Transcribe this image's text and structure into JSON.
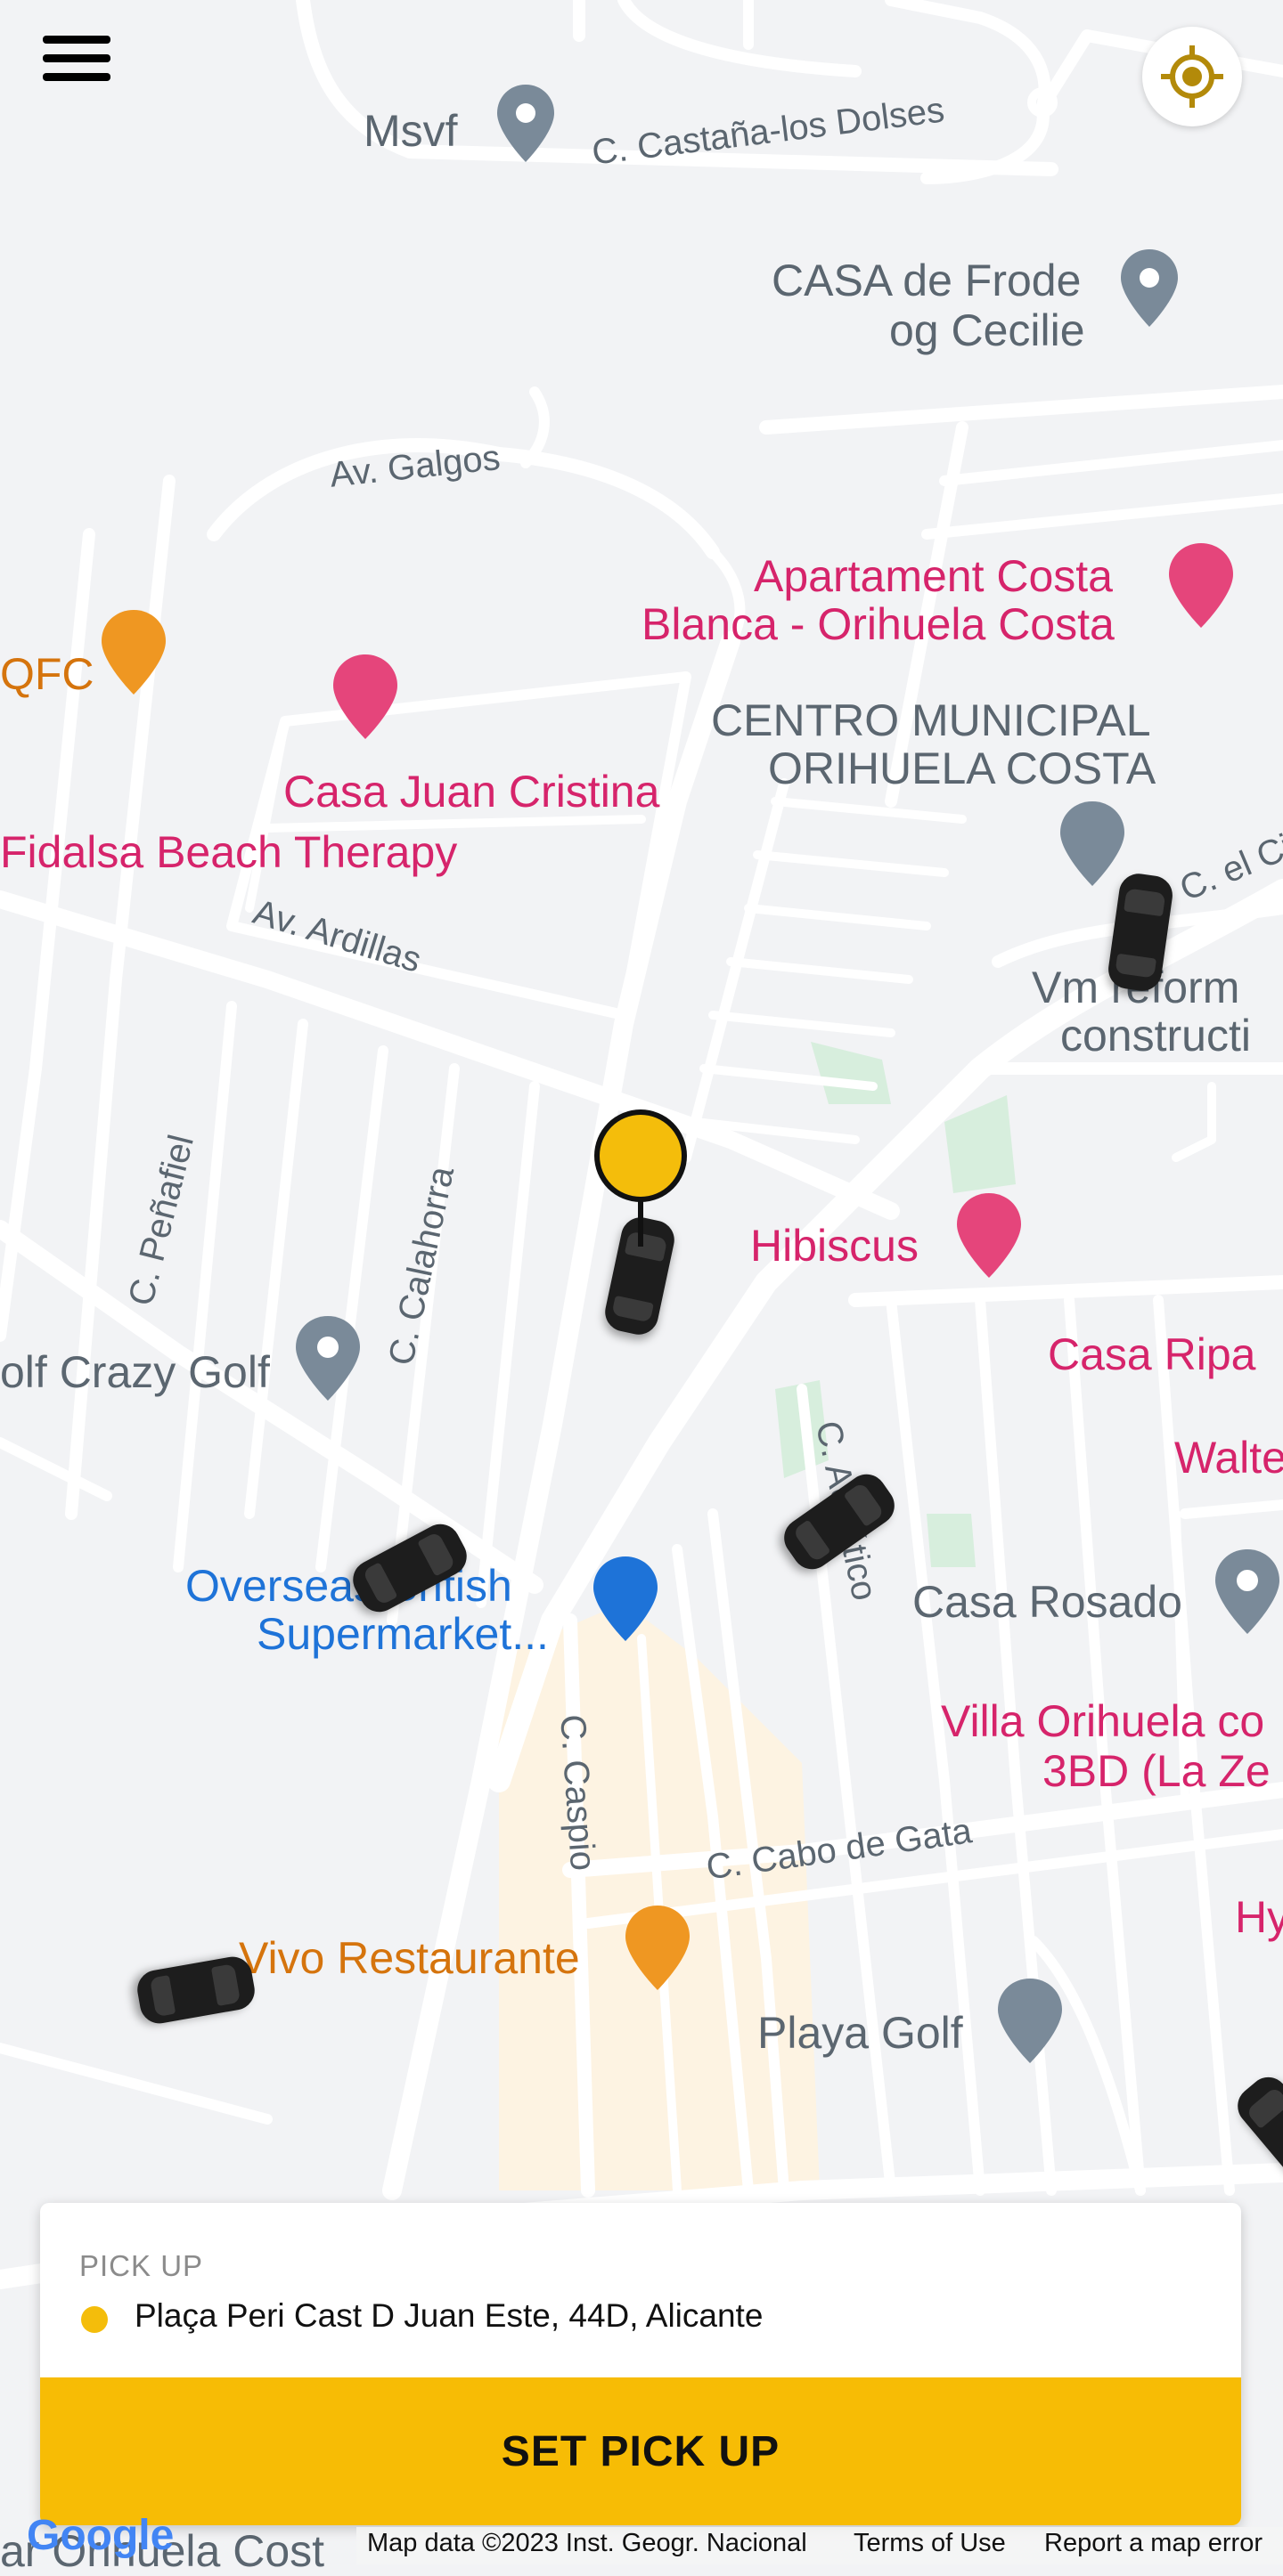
{
  "map": {
    "labels": {
      "msvf": "Msvf",
      "castana": "C. Castaña-los Dolses",
      "casa_frode": "CASA de Frode",
      "og_cecilie": "og Cecilie",
      "galgos": "Av. Galgos",
      "apartament_1": "Apartament Costa",
      "apartament_2": "Blanca - Orihuela Costa",
      "qfc": "QFC",
      "centro_1": "CENTRO MUNICIPAL",
      "centro_2": "ORIHUELA COSTA",
      "casa_juan": "Casa Juan Cristina",
      "fidalsa": "Fidalsa Beach Therapy",
      "ardillas": "Av. Ardillas",
      "el_ci": "C. el Ci",
      "vm_1": "Vm reform",
      "vm_2": "constructi",
      "penafiel": "C. Peñafiel",
      "calahorra": "C. Calahorra",
      "hibiscus": "Hibiscus",
      "casa_ripa": "Casa Ripa",
      "crazy_golf": "olf Crazy Golf",
      "walte": "Walte",
      "c_a_atico": "C. Adriático",
      "overseas_1": "Overseas British",
      "overseas_2": "Supermarket...",
      "casa_rosado": "Casa Rosado",
      "villa_1": "Villa Orihuela co",
      "villa_2": "3BD (La Ze",
      "caspio": "C. Caspio",
      "cabo_gata": "C. Cabo de Gata",
      "vivo": "Vivo Restaurante",
      "hy": "Hy",
      "playa_golf": "Playa Golf",
      "orihuela_cost": "ar Orihuela Cost"
    },
    "colors": {
      "background": "#f2f3f5",
      "road": "#ffffff",
      "park": "#d7eedd",
      "commercial": "#fdf3e2",
      "pin_gray": "#7a8a99",
      "pin_pink": "#e5457b",
      "pin_blue": "#1e73d8",
      "pin_orange": "#ef9722"
    }
  },
  "controls": {
    "menu_icon": "hamburger-menu-icon",
    "locate_icon": "crosshair-location-icon",
    "accent": "#f7bc05"
  },
  "pickup": {
    "heading": "PICK UP",
    "address": "Plaça Peri Cast D Juan Este, 44D, Alicante",
    "button_label": "SET PICK UP"
  },
  "footer": {
    "logo": "Google",
    "map_data": "Map data ©2023 Inst. Geogr. Nacional",
    "terms": "Terms of Use",
    "report": "Report a map error"
  }
}
